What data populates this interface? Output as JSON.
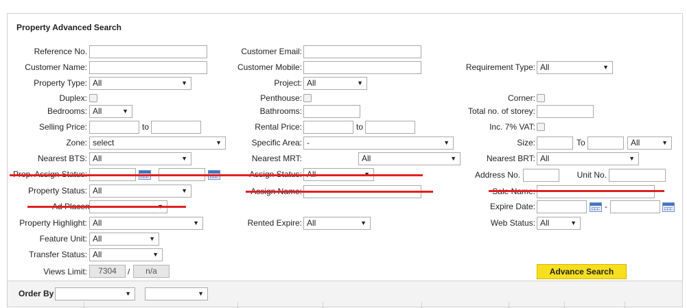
{
  "panel": {
    "title": "Property Advanced Search"
  },
  "labels": {
    "reference_no": "Reference No.",
    "customer_email": "Customer Email:",
    "customer_name": "Customer Name:",
    "customer_mobile": "Customer Mobile:",
    "requirement_type": "Requirement Type:",
    "property_type": "Property Type:",
    "project": "Project:",
    "duplex": "Duplex:",
    "penthouse": "Penthouse:",
    "corner": "Corner:",
    "bedrooms": "Bedrooms:",
    "bathrooms": "Bathrooms:",
    "total_storey": "Total no. of storey:",
    "selling_price": "Selling Price:",
    "to": "to",
    "rental_price": "Rental Price:",
    "inc_vat": "Inc. 7% VAT:",
    "zone": "Zone:",
    "specific_area": "Specific Area:",
    "size": "Size:",
    "size_to": "To",
    "nearest_bts": "Nearest BTS:",
    "nearest_mrt": "Nearest MRT:",
    "nearest_brt": "Nearest BRT:",
    "prop_assign_status": "Prop. Assign Status:",
    "assign_status": "Assign Status:",
    "address_no": "Address No.",
    "unit_no": "Unit No.",
    "property_status": "Property Status:",
    "assign_name": "Assign Name:",
    "sale_name": "Sale Name:",
    "ad_placement": "Ad Placement:",
    "expire_date": "Expire Date:",
    "dash": "-",
    "property_highlight": "Property Highlight:",
    "rented_expire": "Rented Expire:",
    "web_status": "Web Status:",
    "feature_unit": "Feature Unit:",
    "transfer_status": "Transfer Status:",
    "views_limit": "Views Limit:",
    "slash": "/"
  },
  "selects": {
    "requirement_type": "All",
    "property_type": "All",
    "project": "All",
    "bedrooms": "All",
    "zone": "select",
    "specific_area": "-",
    "size_unit": "All",
    "nearest_bts": "All",
    "nearest_mrt": "All",
    "nearest_brt": "All",
    "assign_status": "All",
    "property_status": "All",
    "ad_placement": "",
    "property_highlight": "All",
    "rented_expire": "All",
    "web_status": "All",
    "feature_unit": "All",
    "transfer_status": "All",
    "order_by_1": "",
    "order_by_2": ""
  },
  "views_limit": {
    "used": "7304",
    "limit": "n/a"
  },
  "buttons": {
    "advance_search": "Advance Search"
  },
  "order_bar": {
    "label": "Order By"
  }
}
